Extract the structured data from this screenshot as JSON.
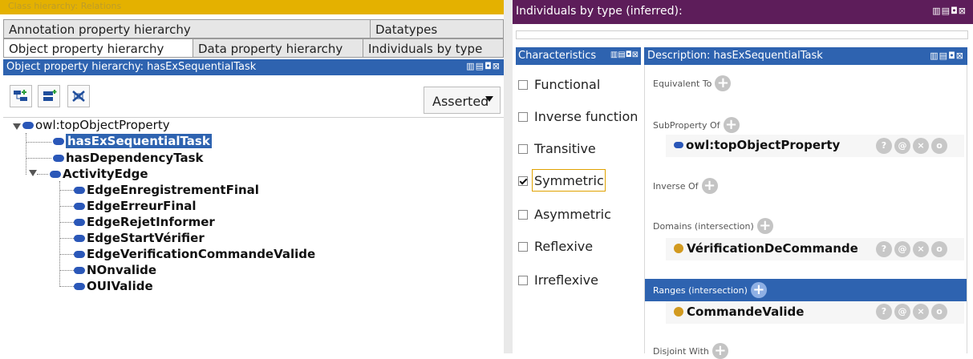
{
  "left_panel": {
    "top_strip_title": "Class hierarchy: Relations",
    "tabs_row1": [
      "Annotation property hierarchy",
      "Datatypes"
    ],
    "tabs_row2": [
      "Object property hierarchy",
      "Data property hierarchy",
      "Individuals by type"
    ],
    "header_title": "Object property hierarchy: hasExSequentialTask",
    "view_controls": "▥▤◘⊠",
    "mode_select": "Asserted",
    "tree": {
      "root": "owl:topObjectProperty",
      "children": [
        "hasExSequentialTask",
        "hasDependencyTask",
        "ActivityEdge"
      ],
      "activity_edge_children": [
        "EdgeEnregistrementFinal",
        "EdgeErreurFinal",
        "EdgeRejetInformer",
        "EdgeStartVérifier",
        "EdgeVerificationCommandeValide",
        "NOnvalide",
        "OUIValide"
      ],
      "selected": "hasExSequentialTask"
    }
  },
  "individuals_panel": {
    "title": "Individuals by type (inferred):",
    "view_controls": "▥▤◘⊠"
  },
  "characteristics_panel": {
    "title": "Characteristics",
    "view_controls": "▥▤◘⊠",
    "items": [
      {
        "label": "Functional",
        "checked": false
      },
      {
        "label": "Inverse function",
        "checked": false
      },
      {
        "label": "Transitive",
        "checked": false
      },
      {
        "label": "Symmetric",
        "checked": true
      },
      {
        "label": "Asymmetric",
        "checked": false
      },
      {
        "label": "Reflexive",
        "checked": false
      },
      {
        "label": "Irreflexive",
        "checked": false
      }
    ]
  },
  "description_panel": {
    "title": "Description: hasExSequentialTask",
    "view_controls": "▥▤◘⊠",
    "sections": {
      "equivalent_to": "Equivalent To",
      "subproperty_of": "SubProperty Of",
      "inverse_of": "Inverse Of",
      "domains": "Domains (intersection)",
      "ranges": "Ranges (intersection)",
      "disjoint_with": "Disjoint With"
    },
    "subproperty_value": "owl:topObjectProperty",
    "domain_value": "VérificationDeCommande",
    "range_value": "CommandeValide",
    "action_icons": [
      "?",
      "@",
      "×",
      "o"
    ]
  },
  "colors": {
    "header_blue": "#2e63b0",
    "header_purple": "#5d1d5a",
    "strip_yellow": "#e4b100",
    "class_dot": "#d29a1f",
    "property_pill": "#2a57b8"
  }
}
